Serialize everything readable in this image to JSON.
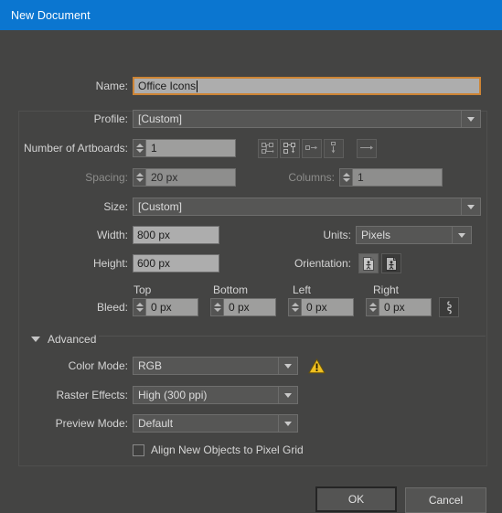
{
  "window": {
    "title": "New Document",
    "titlebar_color": "#0b76d0",
    "background_color": "#444443"
  },
  "fields": {
    "name": {
      "label": "Name:",
      "value": "Office Icons",
      "focused": true
    },
    "profile": {
      "label": "Profile:",
      "value": "[Custom]"
    },
    "number_of_artboards": {
      "label": "Number of Artboards:",
      "value": "1"
    },
    "spacing": {
      "label": "Spacing:",
      "value": "20 px",
      "disabled": true
    },
    "columns": {
      "label": "Columns:",
      "value": "1",
      "disabled": true
    },
    "size": {
      "label": "Size:",
      "value": "[Custom]"
    },
    "width": {
      "label": "Width:",
      "value": "800 px"
    },
    "height": {
      "label": "Height:",
      "value": "600 px"
    },
    "units": {
      "label": "Units:",
      "value": "Pixels"
    },
    "orientation": {
      "label": "Orientation:",
      "portrait_icon": "portrait-orientation-icon",
      "landscape_icon": "landscape-orientation-icon",
      "selected": "portrait"
    },
    "bleed": {
      "label": "Bleed:",
      "top_label": "Top",
      "bottom_label": "Bottom",
      "left_label": "Left",
      "right_label": "Right",
      "top_value": "0 px",
      "bottom_value": "0 px",
      "left_value": "0 px",
      "right_value": "0 px",
      "link_icon": "link-chain-icon"
    }
  },
  "artboard_arrangement": {
    "buttons": [
      {
        "icon": "grid-by-row-icon"
      },
      {
        "icon": "grid-by-column-icon"
      },
      {
        "icon": "arrange-by-row-icon"
      },
      {
        "icon": "arrange-by-column-icon"
      }
    ],
    "direction_button": {
      "icon": "left-to-right-icon"
    }
  },
  "advanced": {
    "label": "Advanced",
    "expanded": true,
    "color_mode": {
      "label": "Color Mode:",
      "value": "RGB",
      "warning_icon": "warning-triangle-icon",
      "warning_color": "#f0c020"
    },
    "raster_effects": {
      "label": "Raster Effects:",
      "value": "High (300 ppi)"
    },
    "preview_mode": {
      "label": "Preview Mode:",
      "value": "Default"
    },
    "align_pixel_grid": {
      "label": "Align New Objects to Pixel Grid",
      "checked": false
    }
  },
  "footer": {
    "ok_label": "OK",
    "cancel_label": "Cancel"
  }
}
